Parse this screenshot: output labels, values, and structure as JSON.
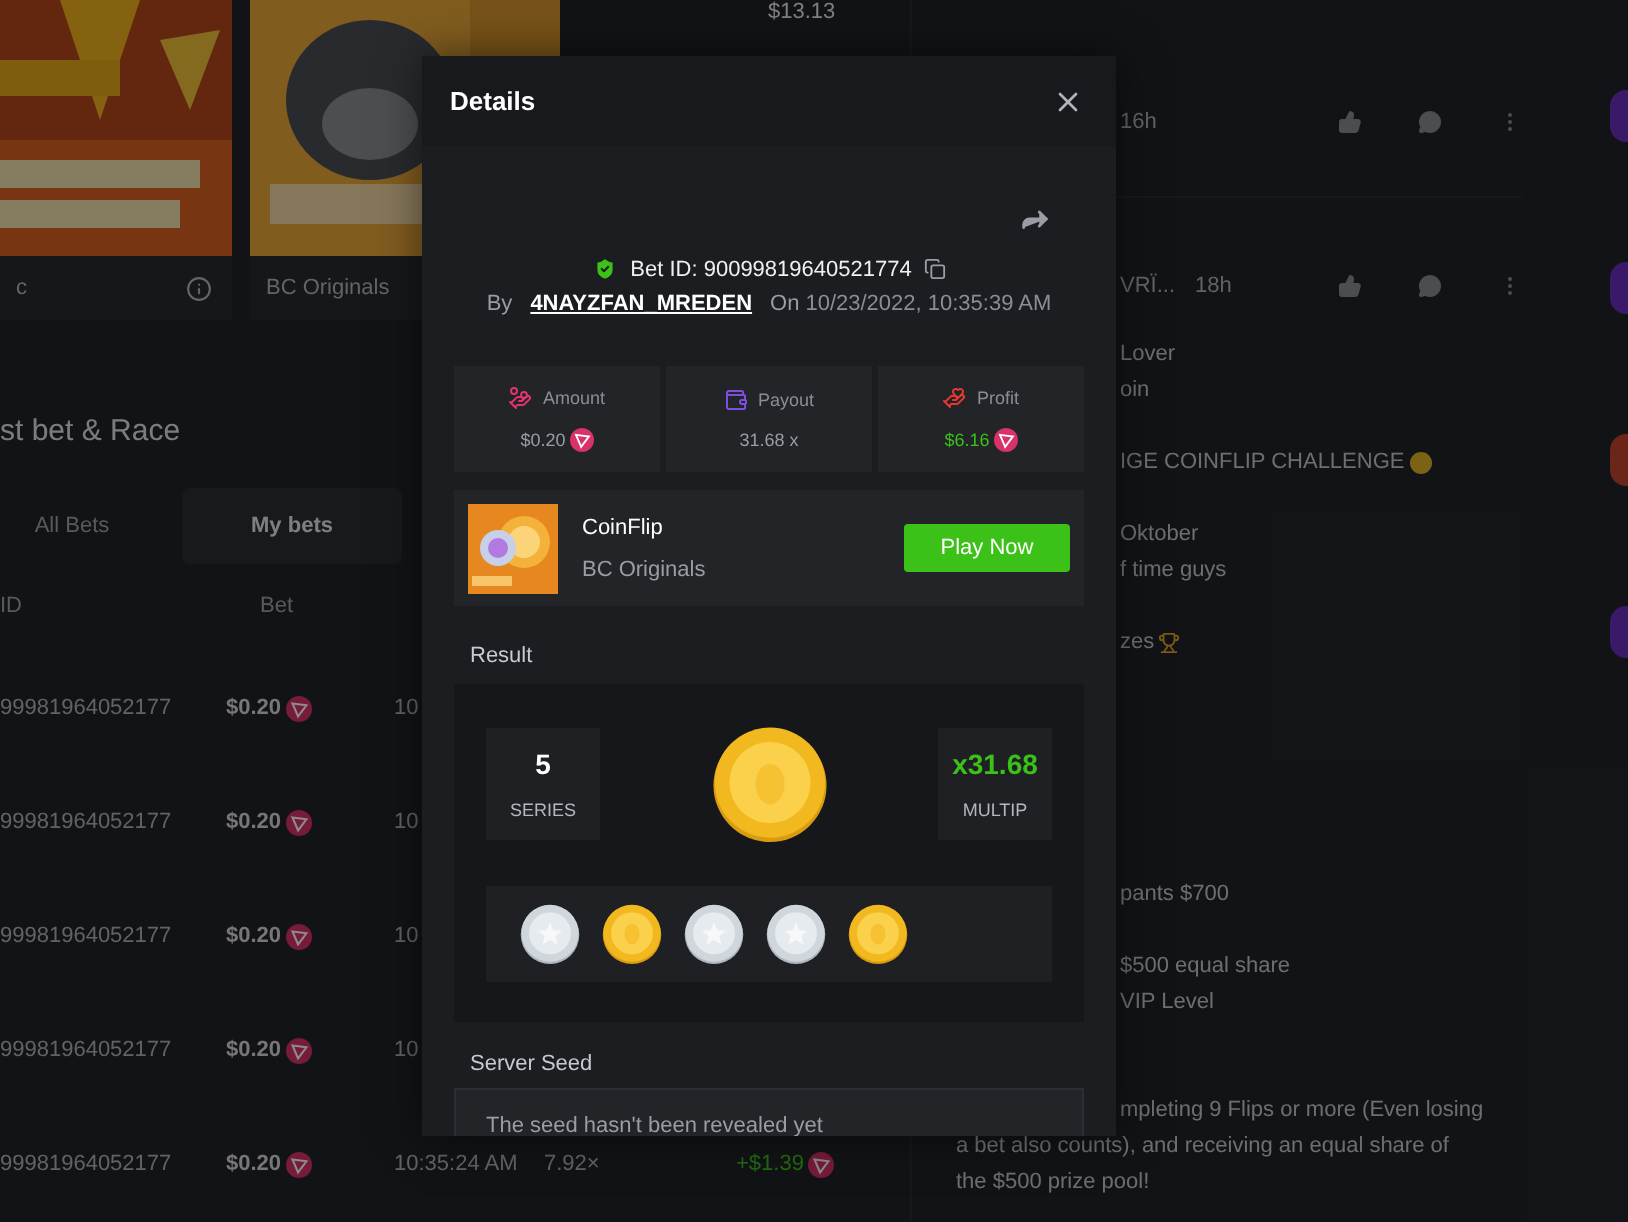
{
  "top_bar": {
    "balance": "$13.13"
  },
  "game_cards": [
    {
      "provider": "c",
      "info": true
    },
    {
      "provider": "BC Originals"
    }
  ],
  "section_title": "st bet & Race",
  "bet_tabs": [
    {
      "label": "All Bets",
      "selected": false
    },
    {
      "label": "My bets",
      "selected": true
    }
  ],
  "bets_table": {
    "columns": [
      "ID",
      "Bet"
    ],
    "rows": [
      {
        "id": "99981964052177",
        "bet": "$0.20",
        "time": "10"
      },
      {
        "id": "99981964052177",
        "bet": "$0.20",
        "time": "10"
      },
      {
        "id": "99981964052177",
        "bet": "$0.20",
        "time": "10"
      },
      {
        "id": "99981964052177",
        "bet": "$0.20",
        "time": "10"
      },
      {
        "id": "99981964052177",
        "bet": "$0.20",
        "time": "10:35:24 AM",
        "payout": "7.92×",
        "profit": "+$1.39"
      }
    ]
  },
  "chat": [
    {
      "kind": "header",
      "age": "16h"
    },
    {
      "kind": "divider"
    },
    {
      "kind": "header",
      "name": "VRÏ...",
      "age": "18h"
    },
    {
      "kind": "partial",
      "text": "Lover"
    },
    {
      "kind": "partial",
      "text": "oin"
    },
    {
      "kind": "gap"
    },
    {
      "kind": "partial",
      "text": "IGE COINFLIP CHALLENGE",
      "coin": true
    },
    {
      "kind": "gap"
    },
    {
      "kind": "partial",
      "text": "Oktober"
    },
    {
      "kind": "partial",
      "text": "f time guys"
    },
    {
      "kind": "gap"
    },
    {
      "kind": "partial",
      "text": "zes",
      "trophy": true
    },
    {
      "kind": "gap"
    },
    {
      "kind": "gap"
    },
    {
      "kind": "gap"
    },
    {
      "kind": "gap"
    },
    {
      "kind": "gap"
    },
    {
      "kind": "gap"
    },
    {
      "kind": "partial",
      "text": "pants $700"
    },
    {
      "kind": "gap"
    },
    {
      "kind": "partial",
      "text": "$500 equal share"
    },
    {
      "kind": "partial",
      "text": "VIP Level"
    },
    {
      "kind": "gap"
    },
    {
      "kind": "gap"
    },
    {
      "kind": "partial",
      "text": "mpleting 9 Flips or more (Even losing"
    },
    {
      "kind": "full",
      "text": "a bet also counts), and receiving an equal share of"
    },
    {
      "kind": "full",
      "text": "the $500 prize pool!"
    }
  ],
  "details_modal": {
    "title": "Details",
    "bet_id": "Bet ID: 90099819640521774",
    "by_label": "By",
    "user": "4NAYZFAN_MREDEN",
    "on_label": "On",
    "date": "10/23/2022, 10:35:39 AM",
    "stats": [
      {
        "kind": "amount",
        "label": "Amount",
        "value": "$0.20",
        "win": false,
        "coin": true
      },
      {
        "kind": "payout",
        "label": "Payout",
        "value": "31.68 x",
        "win": false,
        "coin": false
      },
      {
        "kind": "profit",
        "label": "Profit",
        "value": "$6.16",
        "win": true,
        "coin": true
      }
    ],
    "game": {
      "name": "CoinFlip",
      "provider": "BC Originals",
      "button": "Play Now"
    },
    "result_label": "Result",
    "result": {
      "series": "5",
      "series_label": "SERIES",
      "main_coin_gold": true,
      "multiplier": "x31.68",
      "multiplier_label": "MULTIP",
      "coins": [
        {
          "gold": false
        },
        {
          "gold": true
        },
        {
          "gold": false
        },
        {
          "gold": false
        },
        {
          "gold": true
        }
      ]
    },
    "seed_label": "Server Seed",
    "seed_text": "The seed hasn't been revealed yet"
  }
}
